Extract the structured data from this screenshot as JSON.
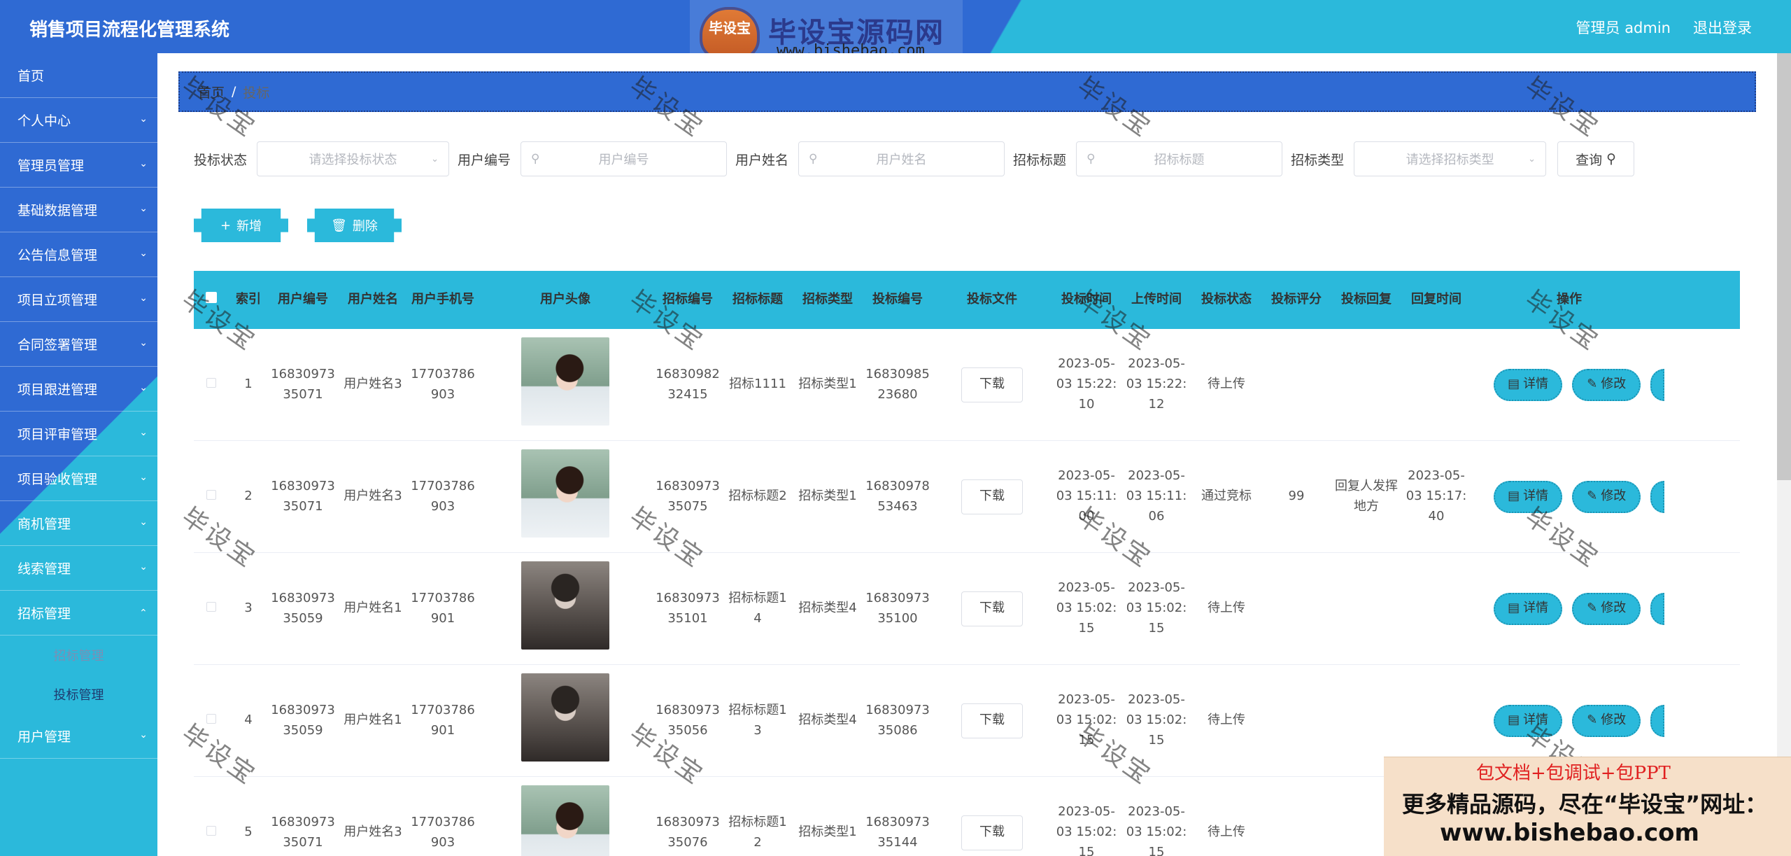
{
  "app_title": "销售项目流程化管理系统",
  "header": {
    "user": "管理员 admin",
    "logout": "退出登录"
  },
  "logo": {
    "badge": "毕设宝",
    "name": "毕设宝源码网",
    "url": "www.bishebao.com"
  },
  "sidebar": {
    "items": [
      {
        "label": "首页"
      },
      {
        "label": "个人中心"
      },
      {
        "label": "管理员管理"
      },
      {
        "label": "基础数据管理"
      },
      {
        "label": "公告信息管理"
      },
      {
        "label": "项目立项管理"
      },
      {
        "label": "合同签署管理"
      },
      {
        "label": "项目跟进管理"
      },
      {
        "label": "项目评审管理"
      },
      {
        "label": "项目验收管理"
      },
      {
        "label": "商机管理"
      },
      {
        "label": "线索管理"
      },
      {
        "label": "招标管理"
      }
    ],
    "sub_items": [
      {
        "label": "招标管理"
      },
      {
        "label": "投标管理"
      }
    ],
    "last_item": {
      "label": "用户管理"
    }
  },
  "breadcrumb": {
    "home": "首页",
    "sep": "/",
    "current": "投标"
  },
  "search": {
    "status_label": "投标状态",
    "status_placeholder": "请选择投标状态",
    "user_no_label": "用户编号",
    "user_no_placeholder": "用户编号",
    "user_name_label": "用户姓名",
    "user_name_placeholder": "用户姓名",
    "title_label": "招标标题",
    "title_placeholder": "招标标题",
    "type_label": "招标类型",
    "type_placeholder": "请选择招标类型",
    "query_button": "查询"
  },
  "actions": {
    "add": "新增",
    "delete": "删除"
  },
  "table": {
    "headers": [
      "索引",
      "用户编号",
      "用户姓名",
      "用户手机号",
      "用户头像",
      "招标编号",
      "招标标题",
      "招标类型",
      "投标编号",
      "投标文件",
      "投标时间",
      "上传时间",
      "投标状态",
      "投标评分",
      "投标回复",
      "回复时间",
      "操作"
    ],
    "download_label": "下载",
    "detail_label": "详情",
    "edit_label": "修改",
    "rows": [
      {
        "index": "1",
        "user_no": "1683097335071",
        "user_name": "用户姓名3",
        "phone": "17703786903",
        "avatar": "girl",
        "bid_no": "1683098232415",
        "title": "招标1111",
        "type": "招标类型1",
        "tender_no": "1683098523680",
        "bid_time": "2023-05-03 15:22:10",
        "upload_time": "2023-05-03 15:22:12",
        "status": "待上传",
        "score": "",
        "reply": "",
        "reply_time": ""
      },
      {
        "index": "2",
        "user_no": "1683097335071",
        "user_name": "用户姓名3",
        "phone": "17703786903",
        "avatar": "girl",
        "bid_no": "1683097335075",
        "title": "招标标题2",
        "type": "招标类型1",
        "tender_no": "1683097853463",
        "bid_time": "2023-05-03 15:11:00",
        "upload_time": "2023-05-03 15:11:06",
        "status": "通过竞标",
        "score": "99",
        "reply": "回复人发挥地方",
        "reply_time": "2023-05-03 15:17:40"
      },
      {
        "index": "3",
        "user_no": "1683097335059",
        "user_name": "用户姓名1",
        "phone": "17703786901",
        "avatar": "boy",
        "bid_no": "1683097335101",
        "title": "招标标题14",
        "type": "招标类型4",
        "tender_no": "1683097335100",
        "bid_time": "2023-05-03 15:02:15",
        "upload_time": "2023-05-03 15:02:15",
        "status": "待上传",
        "score": "",
        "reply": "",
        "reply_time": ""
      },
      {
        "index": "4",
        "user_no": "1683097335059",
        "user_name": "用户姓名1",
        "phone": "17703786901",
        "avatar": "boy",
        "bid_no": "1683097335056",
        "title": "招标标题13",
        "type": "招标类型4",
        "tender_no": "1683097335086",
        "bid_time": "2023-05-03 15:02:15",
        "upload_time": "2023-05-03 15:02:15",
        "status": "待上传",
        "score": "",
        "reply": "",
        "reply_time": ""
      },
      {
        "index": "5",
        "user_no": "1683097335071",
        "user_name": "用户姓名3",
        "phone": "17703786903",
        "avatar": "girl",
        "bid_no": "1683097335076",
        "title": "招标标题12",
        "type": "招标类型1",
        "tender_no": "1683097335144",
        "bid_time": "2023-05-03 15:02:15",
        "upload_time": "2023-05-03 15:02:15",
        "status": "待上传",
        "score": "",
        "reply": "",
        "reply_time": ""
      }
    ]
  },
  "watermark_text": "毕设宝",
  "promo": {
    "line1": "包文档+包调试+包PPT",
    "line2": "更多精品源码，尽在“毕设宝”网址：",
    "line3": "www.bishebao.com"
  },
  "colors": {
    "primary_blue": "#2f6ad3",
    "accent_cyan": "#2bb9db"
  }
}
